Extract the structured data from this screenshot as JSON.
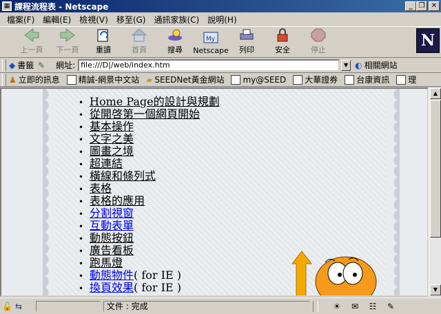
{
  "window": {
    "title": "課程流程表 - Netscape",
    "controls": [
      "_",
      "❐",
      "✕"
    ]
  },
  "menubar": [
    "檔案(F)",
    "編輯(E)",
    "檢視(V)",
    "移至(G)",
    "通訊家族(C)",
    "說明(H)"
  ],
  "toolbar": {
    "buttons": [
      {
        "label": "上一頁",
        "icon": "back-arrow-icon",
        "enabled": false
      },
      {
        "label": "下一頁",
        "icon": "forward-arrow-icon",
        "enabled": false
      },
      {
        "label": "重讀",
        "icon": "reload-icon",
        "enabled": true
      },
      {
        "label": "首頁",
        "icon": "home-icon",
        "enabled": false
      },
      {
        "label": "搜尋",
        "icon": "search-icon",
        "enabled": true
      },
      {
        "label": "Netscape",
        "icon": "netscape-icon",
        "enabled": true
      },
      {
        "label": "列印",
        "icon": "print-icon",
        "enabled": true
      },
      {
        "label": "安全",
        "icon": "lock-icon",
        "enabled": true
      },
      {
        "label": "停止",
        "icon": "stop-icon",
        "enabled": false
      }
    ],
    "logo": "N"
  },
  "location": {
    "bookmarks_label": "書籤",
    "address_label": "網址:",
    "address_value": "file:///D|/web/index.htm",
    "related_label": "相關網站"
  },
  "personal_toolbar": [
    "立即的訊息",
    "精誠-網景中文站",
    "SEEDNet黃金網站",
    "my@SEED",
    "大華證券",
    "台康資訊",
    "理"
  ],
  "content": {
    "items": [
      {
        "text": "Home Page的設計與規劃",
        "suffix": "",
        "visited": true
      },
      {
        "text": "從開啓第一個網頁開始",
        "suffix": "",
        "visited": true
      },
      {
        "text": "基本操作",
        "suffix": "",
        "visited": true
      },
      {
        "text": "文字之美",
        "suffix": "",
        "visited": true
      },
      {
        "text": "圖畫之境",
        "suffix": "",
        "visited": true
      },
      {
        "text": "超連結",
        "suffix": "",
        "visited": true
      },
      {
        "text": "橫線和條列式",
        "suffix": "",
        "visited": true
      },
      {
        "text": "表格",
        "suffix": "",
        "visited": true
      },
      {
        "text": "表格的應用",
        "suffix": "",
        "visited": true
      },
      {
        "text": "分割視窗",
        "suffix": "",
        "visited": false
      },
      {
        "text": "互動表單",
        "suffix": "",
        "visited": false
      },
      {
        "text": "動態按鈕",
        "suffix": "",
        "visited": true
      },
      {
        "text": "廣告看板",
        "suffix": "",
        "visited": true
      },
      {
        "text": "跑馬燈",
        "suffix": "",
        "visited": true
      },
      {
        "text": "動態物件",
        "suffix": "( for IE )",
        "visited": false
      },
      {
        "text": "換頁效果",
        "suffix": "( for IE )",
        "visited": false
      }
    ]
  },
  "statusbar": {
    "text": "文件 : 完成"
  },
  "colors": {
    "titlebar": "#0a246a",
    "chrome": "#d4d0c8",
    "link_unvisited": "#0000ee",
    "link_visited": "#000000"
  }
}
